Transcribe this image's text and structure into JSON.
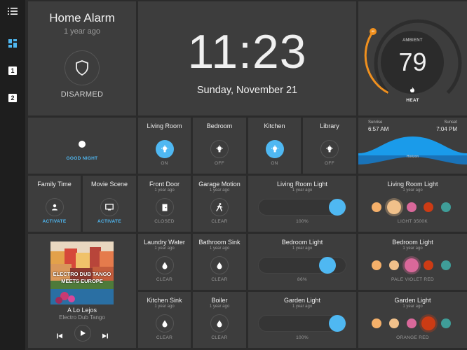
{
  "alarm": {
    "title": "Home Alarm",
    "time": "1 year ago",
    "status": "DISARMED"
  },
  "clock": {
    "time": "11:23",
    "date": "Sunday, November 21"
  },
  "thermostat": {
    "label": "AMBIENT",
    "value": "79",
    "mode": "HEAT",
    "setpoint": "80"
  },
  "scene_good_night": {
    "label": "GOOD NIGHT"
  },
  "rooms": [
    {
      "name": "Living Room",
      "state": "ON",
      "on": true
    },
    {
      "name": "Bedroom",
      "state": "OFF",
      "on": false
    },
    {
      "name": "Kitchen",
      "state": "ON",
      "on": true
    },
    {
      "name": "Library",
      "state": "OFF",
      "on": false
    }
  ],
  "sun": {
    "sunrise_label": "Sunrise",
    "sunrise": "6:57 AM",
    "sunset_label": "Sunset",
    "sunset": "7:04 PM",
    "horizon": "Horizon"
  },
  "scenes": [
    {
      "name": "Family Time",
      "action": "ACTIVATE"
    },
    {
      "name": "Movie Scene",
      "action": "ACTIVATE"
    }
  ],
  "sensors": [
    {
      "name": "Front Door",
      "time": "1 year ago",
      "state": "CLOSED"
    },
    {
      "name": "Garage Motion",
      "time": "1 year ago",
      "state": "CLEAR"
    },
    {
      "name": "Laundry Water",
      "time": "1 year ago",
      "state": "CLEAR"
    },
    {
      "name": "Bathroom Sink",
      "time": "1 year ago",
      "state": "CLEAR"
    },
    {
      "name": "Kitchen Sink",
      "time": "1 year ago",
      "state": "CLEAR"
    },
    {
      "name": "Boiler",
      "time": "1 year ago",
      "state": "CLEAR"
    }
  ],
  "dimmers": [
    {
      "name": "Living Room Light",
      "time": "1 year ago",
      "value": "100%",
      "level": 1.0
    },
    {
      "name": "Bedroom Light",
      "time": "1 year ago",
      "value": "86%",
      "level": 0.86
    },
    {
      "name": "Garden Light",
      "time": "1 year ago",
      "value": "100%",
      "level": 1.0
    }
  ],
  "color_lights": [
    {
      "name": "Living Room Light",
      "time": "1 year ago",
      "color_name": "LIGHT 3500K",
      "selected": 1
    },
    {
      "name": "Bedroom Light",
      "time": "1 year ago",
      "color_name": "PALE VIOLET RED",
      "selected": 2
    },
    {
      "name": "Garden Light",
      "time": "1 year ago",
      "color_name": "ORANGE RED",
      "selected": 3
    }
  ],
  "swatch_colors": [
    "#f5b06a",
    "#f0c08a",
    "#d9689a",
    "#cc3b14",
    "#3f9d98"
  ],
  "media": {
    "album_line1": "ELECTRO DUB TANGO",
    "album_line2": "MEETS EUROPE",
    "track": "A Lo Lejos",
    "artist": "Electro Dub Tango"
  },
  "colors": {
    "accent": "#4fb8f2",
    "orange": "#f0901e",
    "tile": "#3d3d3d",
    "background": "#2b2b2b",
    "sidebar": "#1e1e1e"
  },
  "icons": {
    "menu": "menu-icon",
    "dashboard": "dashboard-icon",
    "page1": "1",
    "page2": "2",
    "shield": "shield-icon",
    "bulb": "bulb-icon",
    "person": "person-icon",
    "tv": "tv-icon",
    "door": "door-icon",
    "motion": "walking-icon",
    "water": "water-drop-icon",
    "prev": "skip-previous-icon",
    "play": "play-icon",
    "next": "skip-next-icon"
  }
}
